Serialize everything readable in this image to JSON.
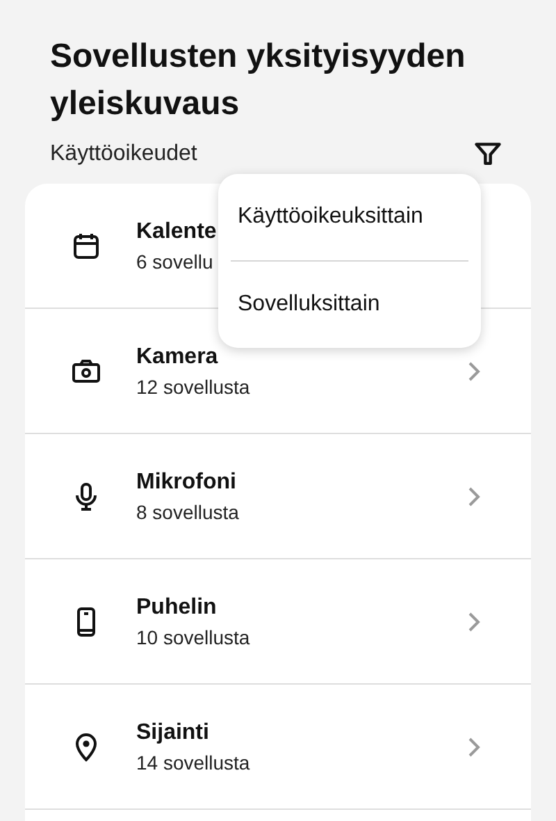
{
  "header": {
    "title": "Sovellusten yksityisyyden yleiskuvaus",
    "subtitle": "Käyttöoikeudet"
  },
  "permissions": [
    {
      "name": "Kalente",
      "count": "6 sovellu",
      "chevron": false
    },
    {
      "name": "Kamera",
      "count": "12 sovellusta",
      "chevron": true
    },
    {
      "name": "Mikrofoni",
      "count": "8 sovellusta",
      "chevron": true
    },
    {
      "name": "Puhelin",
      "count": "10 sovellusta",
      "chevron": true
    },
    {
      "name": "Sijainti",
      "count": "14 sovellusta",
      "chevron": true
    }
  ],
  "filter_menu": {
    "items": [
      "Käyttöoikeuksittain",
      "Sovelluksittain"
    ]
  }
}
